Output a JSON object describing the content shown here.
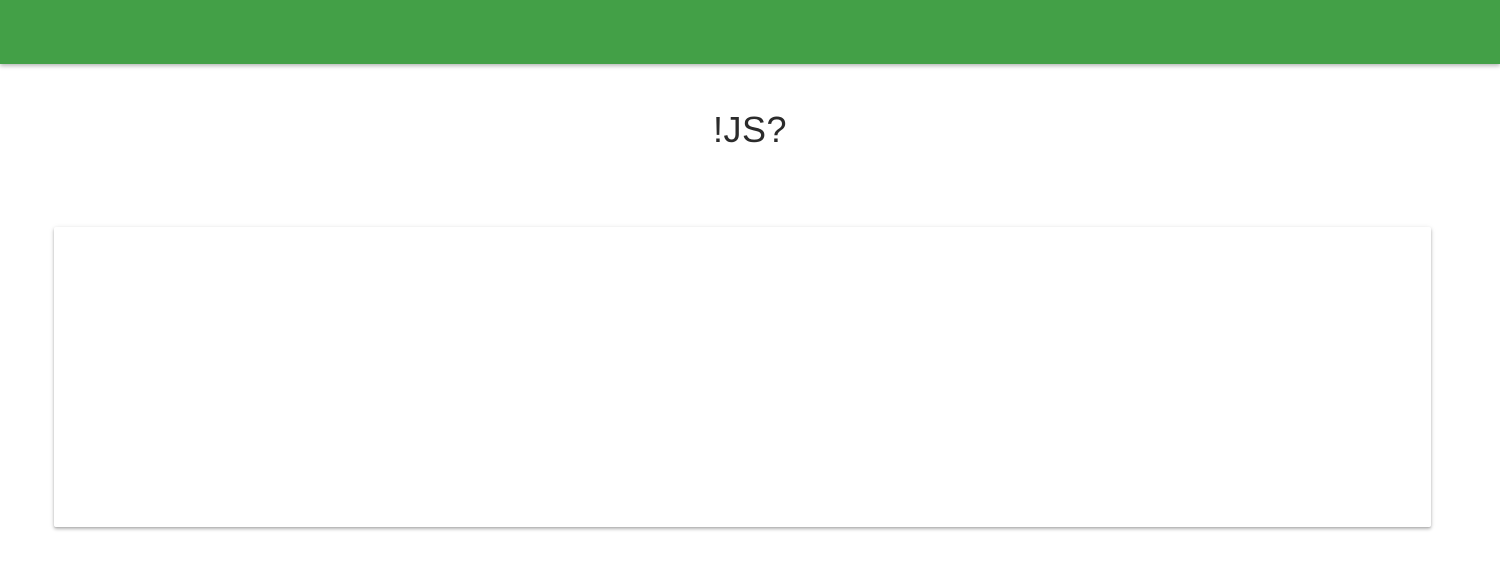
{
  "header": {
    "color": "#43a047"
  },
  "page": {
    "title": "!JS?"
  },
  "card": {
    "background": "#ffffff"
  }
}
